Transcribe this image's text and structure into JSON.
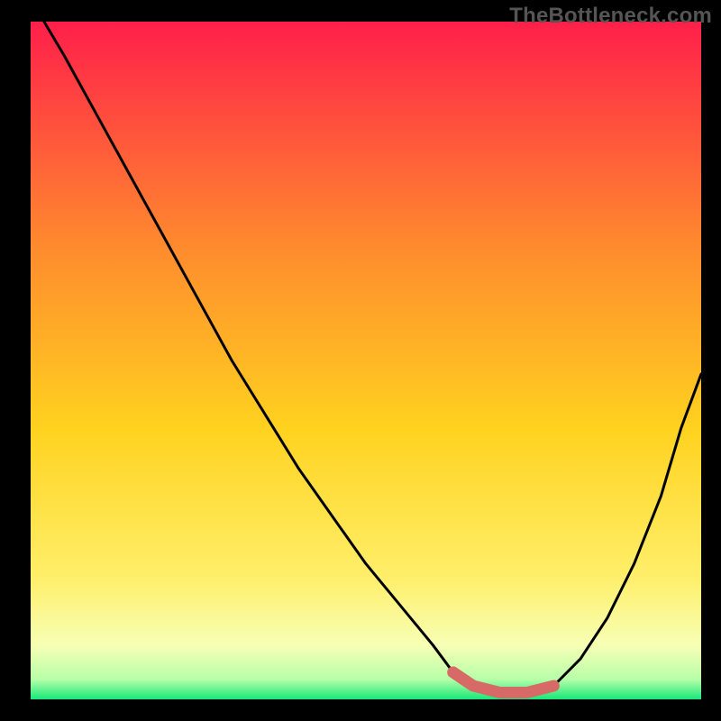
{
  "watermark": "TheBottleneck.com",
  "colors": {
    "bg_black": "#000000",
    "grad_top": "#ff1f4a",
    "grad_mid1": "#ff6a2e",
    "grad_mid2": "#ffd21f",
    "grad_low": "#ffef6a",
    "grad_pale": "#f7ffb5",
    "grad_bottom": "#17e87a",
    "curve": "#000000",
    "marker": "#d76a66"
  },
  "chart_data": {
    "type": "line",
    "title": "",
    "xlabel": "",
    "ylabel": "",
    "xlim": [
      0,
      100
    ],
    "ylim": [
      0,
      100
    ],
    "series": [
      {
        "name": "bottleneck-curve",
        "x": [
          2,
          5,
          10,
          15,
          20,
          25,
          30,
          35,
          40,
          45,
          50,
          55,
          60,
          63,
          66,
          70,
          74,
          78,
          82,
          86,
          90,
          94,
          97,
          100
        ],
        "y": [
          100,
          95,
          86,
          77,
          68,
          59,
          50,
          42,
          34,
          27,
          20,
          14,
          8,
          4,
          2,
          1,
          1,
          2,
          6,
          12,
          20,
          30,
          40,
          48
        ]
      }
    ],
    "marker_segment": {
      "name": "optimal-zone",
      "x": [
        63,
        66,
        70,
        74,
        78
      ],
      "y": [
        4,
        2,
        1,
        1,
        2
      ]
    },
    "annotations": []
  }
}
